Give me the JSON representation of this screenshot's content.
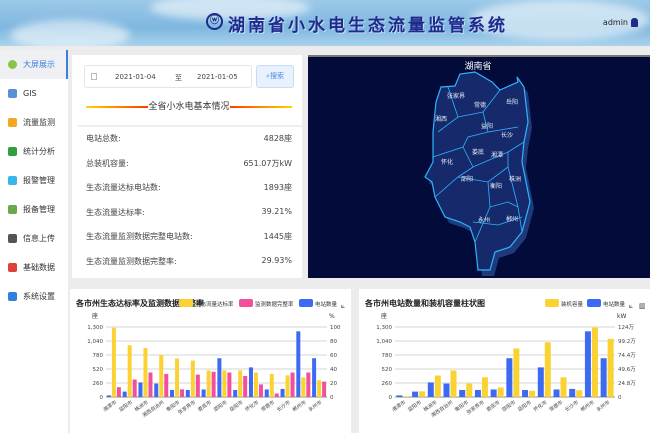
{
  "header": {
    "title": "湖南省小水电生态流量监管系统",
    "user": "admin"
  },
  "sidebar": {
    "items": [
      {
        "label": "大屏展示",
        "icon": "dashboard-icon",
        "color": "#8bc34a",
        "active": true
      },
      {
        "label": "GIS",
        "icon": "globe-icon",
        "color": "#5b8fd6"
      },
      {
        "label": "流量监测",
        "icon": "bar-chart-icon",
        "color": "#f5a623"
      },
      {
        "label": "统计分析",
        "icon": "statistics-icon",
        "color": "#2e9e3e"
      },
      {
        "label": "报警管理",
        "icon": "bell-icon",
        "color": "#37b6e8"
      },
      {
        "label": "报备管理",
        "icon": "report-file-icon",
        "color": "#6aa84f"
      },
      {
        "label": "信息上传",
        "icon": "clipboard-icon",
        "color": "#555"
      },
      {
        "label": "基础数据",
        "icon": "database-icon",
        "color": "#e0403a"
      },
      {
        "label": "系统设置",
        "icon": "gear-icon",
        "color": "#2d7fe0"
      }
    ]
  },
  "filter": {
    "start_date": "2021-01-04",
    "separator": "至",
    "end_date": "2021-01-05",
    "search_label": "搜索"
  },
  "overview": {
    "title": "全省小水电基本情况",
    "rows": [
      {
        "label": "电站总数:",
        "value": "4828座"
      },
      {
        "label": "总装机容量:",
        "value": "651.07万kW"
      },
      {
        "label": "生态流量达标电站数:",
        "value": "1893座"
      },
      {
        "label": "生态流量达标率:",
        "value": "39.21%"
      },
      {
        "label": "生态流量监测数据完整电站数:",
        "value": "1445座"
      },
      {
        "label": "生态流量监测数据完整率:",
        "value": "29.93%"
      }
    ]
  },
  "map": {
    "title": "湖南省",
    "regions": [
      "张家界",
      "常德",
      "岳阳",
      "湘西",
      "益阳",
      "长沙",
      "娄底",
      "湘潭",
      "怀化",
      "邵阳",
      "衡阳",
      "株洲",
      "永州",
      "郴州"
    ]
  },
  "chart_data": [
    {
      "type": "bar",
      "title": "各市州生态达标率及监测数据完整率",
      "categories": [
        "湘潭市",
        "益阳市",
        "株洲市",
        "湘西自治州",
        "衡阳市",
        "张家界市",
        "娄底市",
        "邵阳市",
        "岳阳市",
        "怀化市",
        "常德市",
        "长沙市",
        "郴州市",
        "永州市"
      ],
      "y_left": {
        "unit": "座",
        "ylim": [
          0,
          1300
        ],
        "ticks": [
          "0",
          "260",
          "520",
          "780",
          "1,040",
          "1,300"
        ]
      },
      "y_right": {
        "unit": "%",
        "ylim": [
          0,
          100
        ],
        "ticks": [
          "0",
          "20",
          "40",
          "60",
          "80",
          "100"
        ]
      },
      "legend_position": "top-right",
      "grid": true,
      "series": [
        {
          "name": "电站数量",
          "axis": "left",
          "color": "#3d6af2",
          "values": [
            30,
            100,
            270,
            250,
            130,
            130,
            140,
            720,
            130,
            550,
            140,
            150,
            1220,
            720
          ]
        },
        {
          "name": "生态流量达标率",
          "axis": "right",
          "color": "#fad233",
          "values": [
            99,
            74,
            70,
            60,
            55,
            52,
            38,
            38,
            38,
            35,
            33,
            31,
            28,
            24
          ]
        },
        {
          "name": "监测数据完整率",
          "axis": "right",
          "color": "#f2509c",
          "values": [
            14,
            25,
            35,
            33,
            11,
            32,
            36,
            35,
            30,
            18,
            5,
            35,
            35,
            22
          ]
        }
      ],
      "order": [
        "电站数量",
        "生态流量达标率",
        "监测数据完整率"
      ],
      "legend_order": [
        "生态流量达标率",
        "监测数据完整率",
        "电站数量"
      ]
    },
    {
      "type": "bar",
      "title": "各市州电站数量和装机容量柱状图",
      "categories": [
        "湘潭市",
        "益阳市",
        "株洲市",
        "湘西自治州",
        "衡阳市",
        "张家界市",
        "娄底市",
        "邵阳市",
        "岳阳市",
        "怀化市",
        "常德市",
        "长沙市",
        "郴州市",
        "永州市"
      ],
      "y_left": {
        "unit": "座",
        "ylim": [
          0,
          1300
        ],
        "ticks": [
          "0",
          "260",
          "520",
          "780",
          "1,040",
          "1,300"
        ]
      },
      "y_right": {
        "unit": "kW",
        "ylim": [
          0,
          124
        ],
        "ticks": [
          "0",
          "24.8万",
          "49.6万",
          "74.4万",
          "99.2万",
          "124万"
        ]
      },
      "legend_position": "top-right",
      "grid": true,
      "series": [
        {
          "name": "电站数量",
          "axis": "left",
          "color": "#3d6af2",
          "values": [
            30,
            100,
            270,
            250,
            130,
            130,
            140,
            720,
            130,
            550,
            140,
            150,
            1220,
            720
          ]
        },
        {
          "name": "装机容量",
          "axis": "right",
          "color": "#fad233",
          "values": [
            1.2,
            10,
            38,
            47,
            24,
            35,
            17,
            86,
            11,
            97,
            35,
            12,
            123,
            103
          ]
        }
      ],
      "order": [
        "电站数量",
        "装机容量"
      ],
      "legend_order": [
        "装机容量",
        "电站数量"
      ]
    }
  ]
}
